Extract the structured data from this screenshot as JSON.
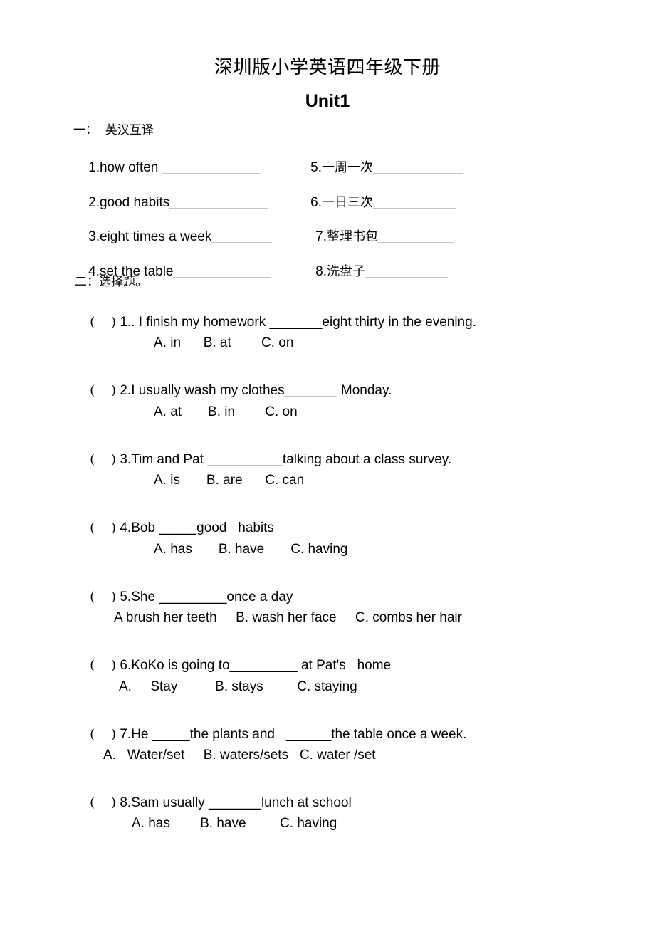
{
  "document": {
    "title": "深圳版小学英语四年级下册",
    "unit": "Unit1"
  },
  "section_one": {
    "heading": "一：  英汉互译",
    "items": [
      {
        "number": "1.",
        "term": "how often ",
        "blank": "_____________"
      },
      {
        "number": "2.",
        "term": "good habits",
        "blank": "_____________"
      },
      {
        "number": "3.",
        "term": "eight times a week",
        "blank": "________"
      },
      {
        "number": "4.",
        "term": "set the table",
        "blank": "_____________"
      },
      {
        "number": "5.",
        "term": "一周一次",
        "blank": "____________"
      },
      {
        "number": "6.",
        "term": "一日三次",
        "blank": "___________"
      },
      {
        "number": "7.",
        "term": "整理书包",
        "blank": "__________"
      },
      {
        "number": "8.",
        "term": "洗盘子",
        "blank": "___________"
      }
    ]
  },
  "section_two": {
    "heading": "二：选择题。",
    "bracket": "(    )",
    "questions": [
      {
        "number": "1..",
        "text": " I finish my homework _______eight thirty in the evening.",
        "options": "A. in      B. at        C. on"
      },
      {
        "number": "2.",
        "text": "I usually wash my clothes_______ Monday.",
        "options": "A. at       B. in        C. on"
      },
      {
        "number": "3.",
        "text": "Tim and Pat __________talking about a class survey.",
        "options": "A. is       B. are      C. can"
      },
      {
        "number": "4.",
        "text": "Bob _____good   habits",
        "options": "A. has       B. have       C. having"
      },
      {
        "number": "5.",
        "text": "She _________once a day",
        "options": "A brush her teeth     B. wash her face     C. combs her hair"
      },
      {
        "number": "6.",
        "text": "KoKo is going to_________ at Pat's   home",
        "options": "A.     Stay          B. stays         C. staying"
      },
      {
        "number": "7.",
        "text": "He _____the plants and   ______the table once a week.",
        "options": "A.   Water/set     B. waters/sets   C. water /set"
      },
      {
        "number": "8.",
        "text": "Sam usually _______lunch at school",
        "options": "A. has        B. have         C. having"
      }
    ]
  }
}
